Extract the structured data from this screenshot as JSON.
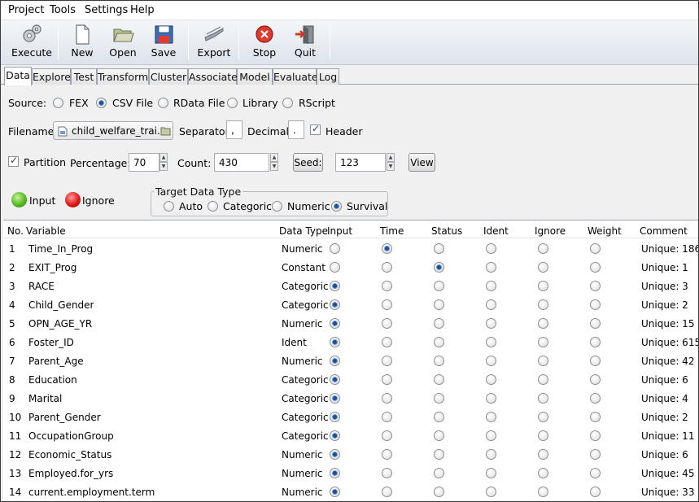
{
  "menu": [
    "Project",
    "Tools",
    "Settings",
    "Help"
  ],
  "toolbar": {
    "execute": "Execute",
    "new": "New",
    "open": "Open",
    "save": "Save",
    "export": "Export",
    "stop": "Stop",
    "quit": "Quit"
  },
  "tabs": [
    "Data",
    "Explore",
    "Test",
    "Transform",
    "Cluster",
    "Associate",
    "Model",
    "Evaluate",
    "Log"
  ],
  "active_tab": "Data",
  "source": {
    "label": "Source:",
    "options": [
      "FEX",
      "CSV File",
      "RData File",
      "Library",
      "RScript"
    ],
    "selected": "CSV File"
  },
  "file": {
    "filename_label": "Filename:",
    "filename_value": "child_welfare_trai...",
    "separator_label": "Separator:",
    "separator_value": ",",
    "decimal_label": "Decimal:",
    "decimal_value": ".",
    "header_label": "Header",
    "header_checked": true
  },
  "partition": {
    "label": "Partition",
    "checked": true,
    "percentage_label": "Percentage:",
    "percentage_value": "70",
    "count_label": "Count:",
    "count_value": "430",
    "seed_button": "Seed:",
    "seed_value": "123",
    "view_button": "View"
  },
  "legend": {
    "input": "Input",
    "ignore": "Ignore"
  },
  "target": {
    "title": "Target Data Type",
    "options": [
      "Auto",
      "Categoric",
      "Numeric",
      "Survival"
    ],
    "selected": "Survival"
  },
  "grid": {
    "columns": [
      "No.",
      "Variable",
      "Data Type",
      "Input",
      "Time",
      "Status",
      "Ident",
      "Ignore",
      "Weight",
      "Comment"
    ],
    "rows": [
      {
        "no": "1",
        "variable": "Time_In_Prog",
        "type": "Numeric",
        "role": "Time",
        "comment": "Unique: 186"
      },
      {
        "no": "2",
        "variable": "EXIT_Prog",
        "type": "Constant",
        "role": "Status",
        "comment": "Unique: 1"
      },
      {
        "no": "3",
        "variable": "RACE",
        "type": "Categoric",
        "role": "Input",
        "comment": "Unique: 3"
      },
      {
        "no": "4",
        "variable": "Child_Gender",
        "type": "Categoric",
        "role": "Input",
        "comment": "Unique: 2"
      },
      {
        "no": "5",
        "variable": "OPN_AGE_YR",
        "type": "Numeric",
        "role": "Input",
        "comment": "Unique: 15"
      },
      {
        "no": "6",
        "variable": "Foster_ID",
        "type": "Ident",
        "role": "Input",
        "comment": "Unique: 615"
      },
      {
        "no": "7",
        "variable": "Parent_Age",
        "type": "Numeric",
        "role": "Input",
        "comment": "Unique: 42"
      },
      {
        "no": "8",
        "variable": "Education",
        "type": "Categoric",
        "role": "Input",
        "comment": "Unique: 6"
      },
      {
        "no": "9",
        "variable": "Marital",
        "type": "Categoric",
        "role": "Input",
        "comment": "Unique: 4"
      },
      {
        "no": "10",
        "variable": "Parent_Gender",
        "type": "Categoric",
        "role": "Input",
        "comment": "Unique: 2"
      },
      {
        "no": "11",
        "variable": "OccupationGroup",
        "type": "Categoric",
        "role": "Input",
        "comment": "Unique: 11"
      },
      {
        "no": "12",
        "variable": "Economic_Status",
        "type": "Numeric",
        "role": "Input",
        "comment": "Unique: 6"
      },
      {
        "no": "13",
        "variable": "Employed.for_yrs",
        "type": "Numeric",
        "role": "Input",
        "comment": "Unique: 45"
      },
      {
        "no": "14",
        "variable": "current.employment.term",
        "type": "Numeric",
        "role": "Input",
        "comment": "Unique: 33"
      }
    ]
  }
}
